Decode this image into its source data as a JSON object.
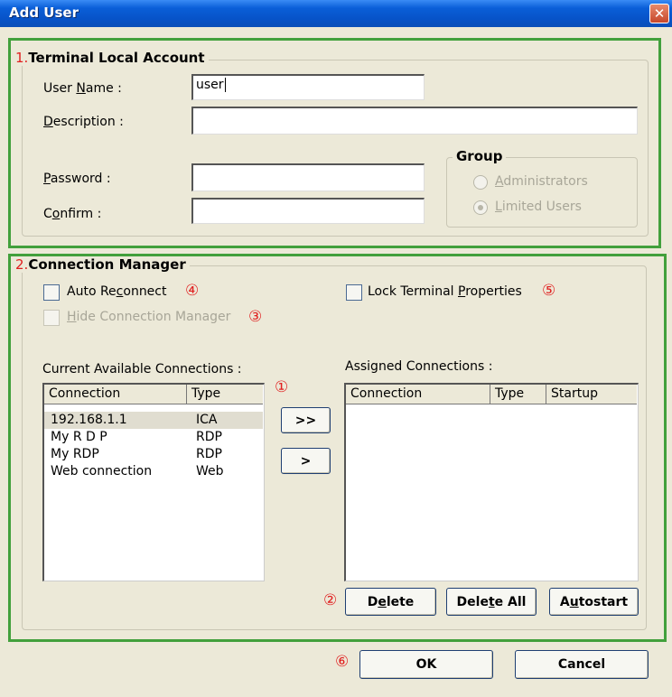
{
  "window": {
    "title": "Add User",
    "close_label": "✕"
  },
  "terminal": {
    "number": "1.",
    "title": "Terminal Local Account",
    "username_label": "User Name :",
    "username_value": "user",
    "description_label": "Description :",
    "description_value": "",
    "password_label": "Password :",
    "confirm_label": "Confirm :",
    "group": {
      "title": "Group",
      "options": [
        {
          "label": "Administrators",
          "selected": false
        },
        {
          "label": "Limited Users",
          "selected": true
        }
      ]
    }
  },
  "connection": {
    "number": "2.",
    "title": "Connection Manager",
    "auto_reconnect": {
      "label": "Auto Reconnect",
      "checked": false,
      "marker": "④"
    },
    "lock_terminal": {
      "label": "Lock Terminal Properties",
      "checked": false,
      "marker": "⑤"
    },
    "hide_manager": {
      "label": "Hide Connection Manager",
      "checked": false,
      "marker": "③"
    },
    "available": {
      "label": "Current Available Connections :",
      "columns": [
        "Connection",
        "Type"
      ],
      "rows": [
        {
          "name": "192.168.1.1",
          "type": "ICA"
        },
        {
          "name": "My R D P",
          "type": "RDP"
        },
        {
          "name": "My RDP",
          "type": "RDP"
        },
        {
          "name": "Web connection",
          "type": "Web"
        }
      ]
    },
    "assigned": {
      "label": "Assigned Connections :",
      "columns": [
        "Connection",
        "Type",
        "Startup"
      ]
    },
    "add_all_label": ">>",
    "add_one_label": ">",
    "arrows_marker": "①",
    "buttons_marker": "②",
    "delete_label": "Delete",
    "delete_all_label": "Delete All",
    "autostart_label": "Autostart"
  },
  "footer": {
    "marker": "⑥",
    "ok_label": "OK",
    "cancel_label": "Cancel"
  }
}
